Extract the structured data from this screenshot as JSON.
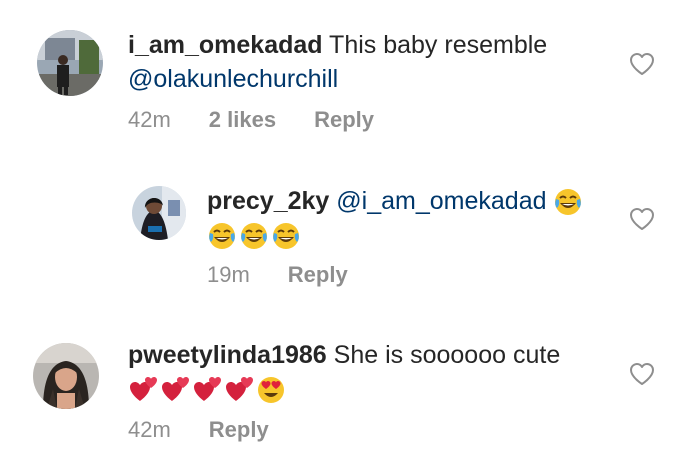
{
  "comments": [
    {
      "username": "i_am_omekadad",
      "text": "This baby resemble",
      "mention": "@olakunlechurchill",
      "time": "42m",
      "likes": "2 likes",
      "reply_label": "Reply"
    },
    {
      "username": "precy_2ky",
      "mention": "@i_am_omekadad",
      "emojis": [
        "face-with-tears-of-joy",
        "face-with-tears-of-joy",
        "face-with-tears-of-joy",
        "face-with-tears-of-joy"
      ],
      "time": "19m",
      "reply_label": "Reply"
    },
    {
      "username": "pweetylinda1986",
      "text": "She is soooooo cute",
      "emojis": [
        "two-hearts",
        "two-hearts",
        "two-hearts",
        "two-hearts",
        "heart-eyes"
      ],
      "time": "42m",
      "reply_label": "Reply"
    }
  ],
  "icons": {
    "like": "heart-outline-icon"
  },
  "colors": {
    "username": "#262626",
    "mention": "#00376b",
    "meta": "#8e8e8e",
    "heart_stroke": "#8e8e8e"
  }
}
